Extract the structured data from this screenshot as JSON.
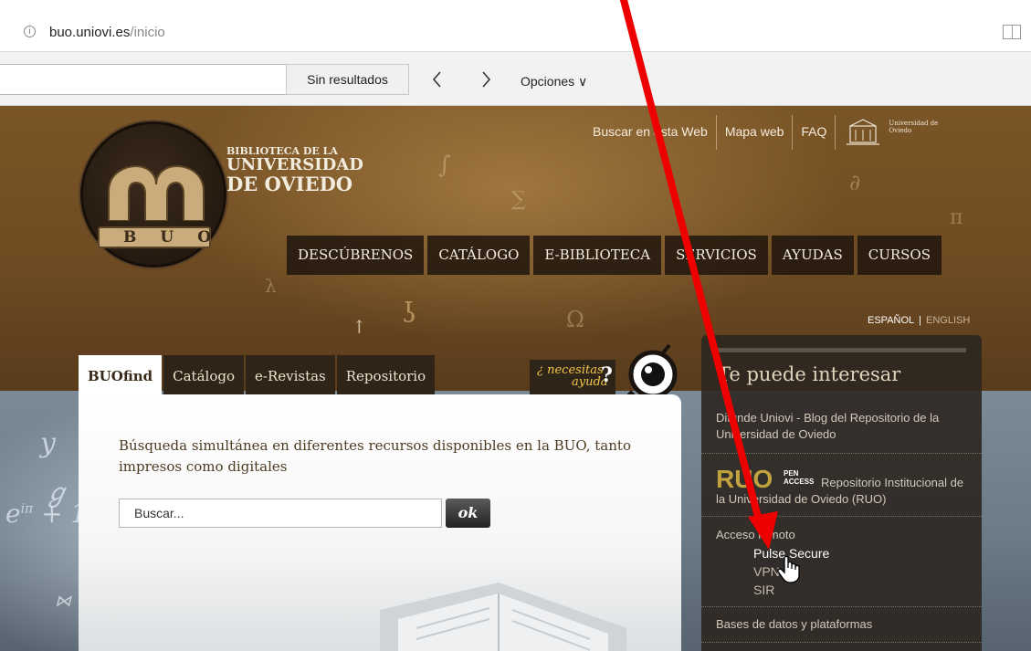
{
  "browser": {
    "url_domain": "buo.uniovi.es",
    "url_path": "/inicio",
    "info_icon": "info-circle-icon",
    "reader_icon": "reading-view-icon"
  },
  "find_bar": {
    "input_value": "",
    "result_text": "Sin resultados",
    "prev_glyph": "〈",
    "next_glyph": "〉",
    "options_label": "Opciones ∨"
  },
  "header": {
    "logo": {
      "line1": "Biblioteca de la",
      "line2": "Universidad",
      "line3": "de Oviedo",
      "band": "BUO"
    },
    "top_links": [
      "Buscar en esta Web",
      "Mapa web",
      "FAQ"
    ],
    "university_name_1": "Universidad de",
    "university_name_2": "Oviedo",
    "nav": [
      "DESCÚBRENOS",
      "CATÁLOGO",
      "E-BIBLIOTECA",
      "SERVICIOS",
      "AYUDAS",
      "CURSOS"
    ],
    "lang_es": "ESPAÑOL",
    "lang_sep": "|",
    "lang_en": "ENGLISH"
  },
  "search": {
    "tabs": [
      "BUOfind",
      "Catálogo",
      "e-Revistas",
      "Repositorio"
    ],
    "help_line1": "¿ necesitas",
    "help_line2": "ayuda",
    "help_q": "?",
    "description": "Búsqueda simultánea en diferentes recursos disponibles en la BUO, tanto impresos como digitales",
    "input_value": "Buscar...",
    "ok_label": "ok"
  },
  "sidebar": {
    "title": "Te puede interesar",
    "blog": "Difunde Uniovi - Blog del Repositorio de la Universidad de Oviedo",
    "ruo_logo": "RUO",
    "ruo_open_1": "PEN",
    "ruo_open_2": "ACCESS",
    "ruo_text": "Repositorio Institucional de la Universidad de Oviedo (RUO)",
    "remote_access": "Acceso remoto",
    "remote_items": [
      "Pulse Secure",
      "VPN",
      "SIR"
    ],
    "databases": "Bases de datos y plataformas"
  },
  "colors": {
    "annotation_arrow": "#ee0000",
    "pulse_secure_text": "#ffffff",
    "sub_item_text": "#c4bbad"
  }
}
